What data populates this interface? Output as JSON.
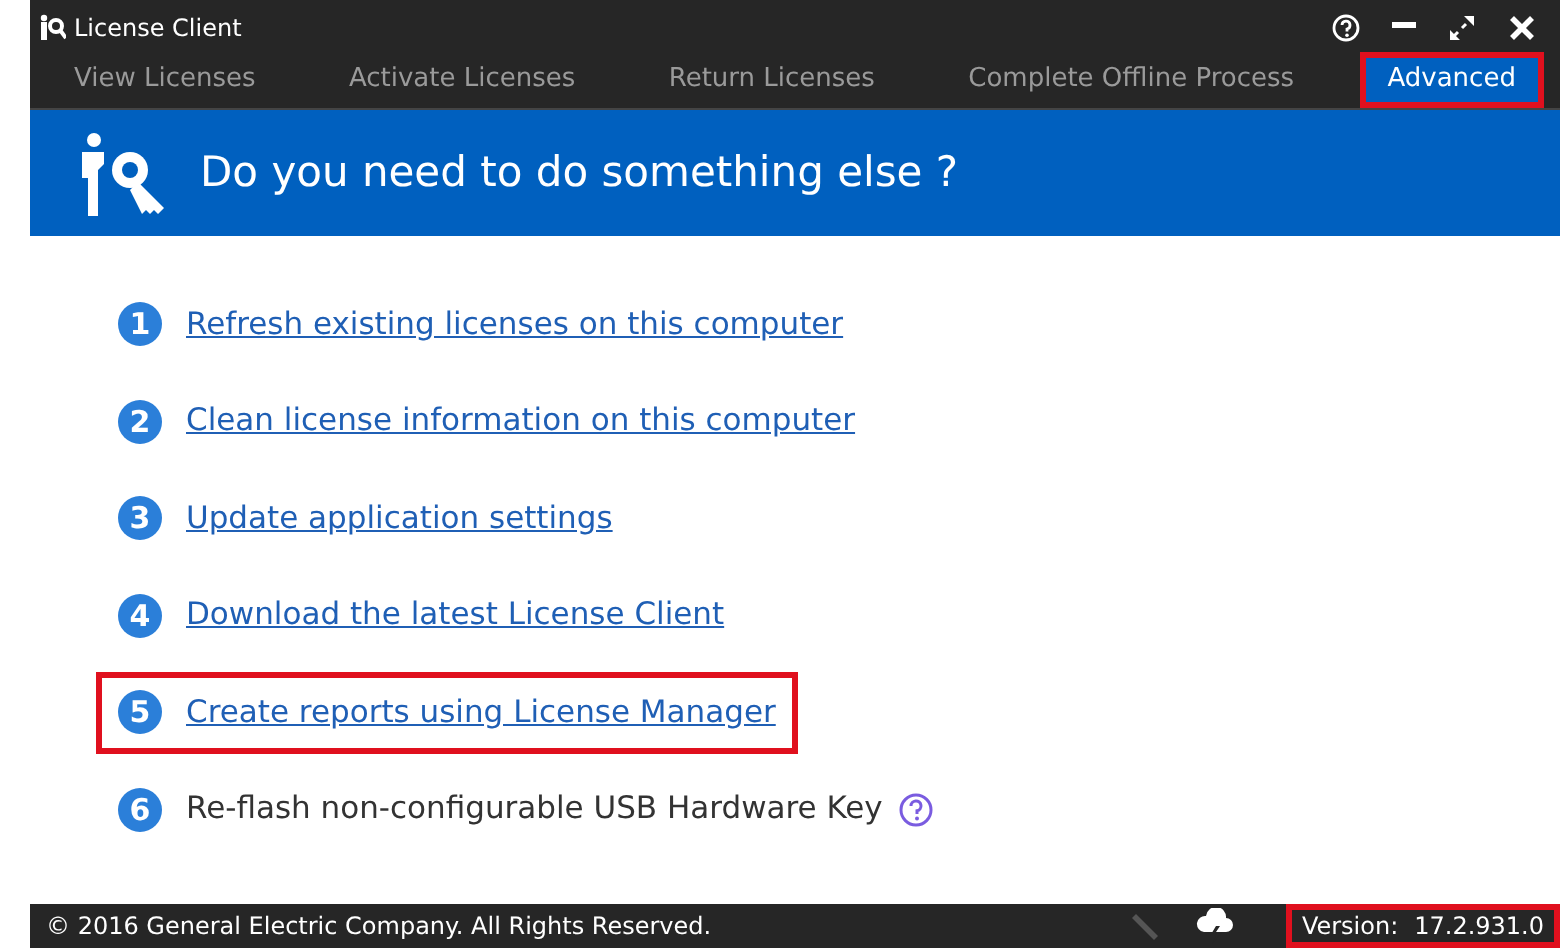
{
  "window": {
    "title": "License Client"
  },
  "tabs": [
    {
      "label": "View Licenses",
      "selected": false,
      "highlighted": false
    },
    {
      "label": "Activate Licenses",
      "selected": false,
      "highlighted": false
    },
    {
      "label": "Return Licenses",
      "selected": false,
      "highlighted": false
    },
    {
      "label": "Complete Offline Process",
      "selected": false,
      "highlighted": false
    },
    {
      "label": "Advanced",
      "selected": true,
      "highlighted": true
    }
  ],
  "banner": {
    "title": "Do you need to do something else ?"
  },
  "actions": [
    {
      "number": "1",
      "label": "Refresh existing licenses on this computer",
      "kind": "link",
      "highlighted": false
    },
    {
      "number": "2",
      "label": "Clean license information on this computer",
      "kind": "link",
      "highlighted": false
    },
    {
      "number": "3",
      "label": "Update application settings",
      "kind": "link",
      "highlighted": false
    },
    {
      "number": "4",
      "label": "Download the latest License Client",
      "kind": "link",
      "highlighted": false
    },
    {
      "number": "5",
      "label": "Create reports using License Manager",
      "kind": "link",
      "highlighted": true
    },
    {
      "number": "6",
      "label": "Re-flash non-configurable USB Hardware Key",
      "kind": "text",
      "highlighted": false
    }
  ],
  "status_bar": {
    "copyright": "© 2016 General Electric Company.  All Rights Reserved.",
    "version_label": "Version:",
    "version": "17.2.931.0",
    "version_highlighted": true
  }
}
